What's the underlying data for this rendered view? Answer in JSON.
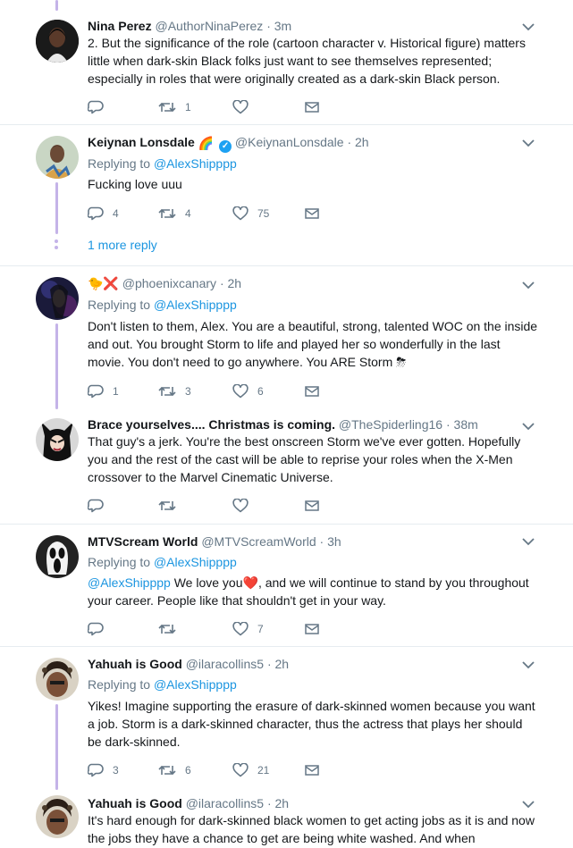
{
  "tweets": [
    {
      "name": "Nina Perez",
      "handle": "@AuthorNinaPerez",
      "time": "3m",
      "text": "2. But the significance of the role (cartoon character v. Historical figure) matters little when dark-skin Black folks just want to see themselves represented; especially in roles that were originally created as a dark-skin Black person.",
      "reply_count": "",
      "retweet_count": "1",
      "like_count": ""
    },
    {
      "name": "Keiynan Lonsdale",
      "name_emoji": "🌈",
      "handle": "@KeiynanLonsdale",
      "time": "2h",
      "replying_prefix": "Replying to",
      "replying_to": "@AlexShipppp",
      "text": "Fucking love uuu",
      "reply_count": "4",
      "retweet_count": "4",
      "like_count": "75",
      "more_replies": "1 more reply"
    },
    {
      "name": "🐤❌",
      "handle": "@phoenixcanary",
      "time": "2h",
      "replying_prefix": "Replying to",
      "replying_to": "@AlexShipppp",
      "text": "Don't listen to them, Alex. You are a beautiful, strong, talented WOC on the inside and out. You brought Storm to life and played her so wonderfully in the last movie. You don't need to go anywhere. You ARE Storm ⛈",
      "reply_count": "1",
      "retweet_count": "3",
      "like_count": "6"
    },
    {
      "name": "Brace yourselves.... Christmas is coming.",
      "handle": "@TheSpiderling16",
      "time": "38m",
      "text": "That guy's a jerk. You're the best onscreen Storm we've ever gotten. Hopefully you and the rest of the cast will be able to reprise your roles when the X-Men crossover to the Marvel Cinematic Universe.",
      "reply_count": "",
      "retweet_count": "",
      "like_count": ""
    },
    {
      "name": "MTVScream World",
      "handle": "@MTVScreamWorld",
      "time": "3h",
      "replying_prefix": "Replying to",
      "replying_to": "@AlexShipppp",
      "text_mention": "@AlexShipppp",
      "text_a": " We love you",
      "text_heart": "❤️",
      "text_b": ", and we will continue to stand by you throughout your career. People like that shouldn't get in your way.",
      "reply_count": "",
      "retweet_count": "",
      "like_count": "7"
    },
    {
      "name": "Yahuah is Good",
      "handle": "@ilaracollins5",
      "time": "2h",
      "replying_prefix": "Replying to",
      "replying_to": "@AlexShipppp",
      "text": "Yikes! Imagine supporting the erasure of dark-skinned women because you want a job. Storm is a dark-skinned character, thus the actress that plays her should be dark-skinned.",
      "reply_count": "3",
      "retweet_count": "6",
      "like_count": "21"
    },
    {
      "name": "Yahuah is Good",
      "handle": "@ilaracollins5",
      "time": "2h",
      "text": "It's hard enough for dark-skinned black women to get acting jobs as it is and now the jobs they have a chance to get are being white washed. And when"
    }
  ],
  "separator": "·",
  "icons": {
    "reply": "reply-icon",
    "retweet": "retweet-icon",
    "like": "heart-icon",
    "dm": "envelope-icon",
    "menu": "chevron-down-icon"
  },
  "colors": {
    "link": "#1b95e0",
    "muted": "#657786",
    "thread": "#c4b3e8",
    "verified": "#1da1f2"
  }
}
